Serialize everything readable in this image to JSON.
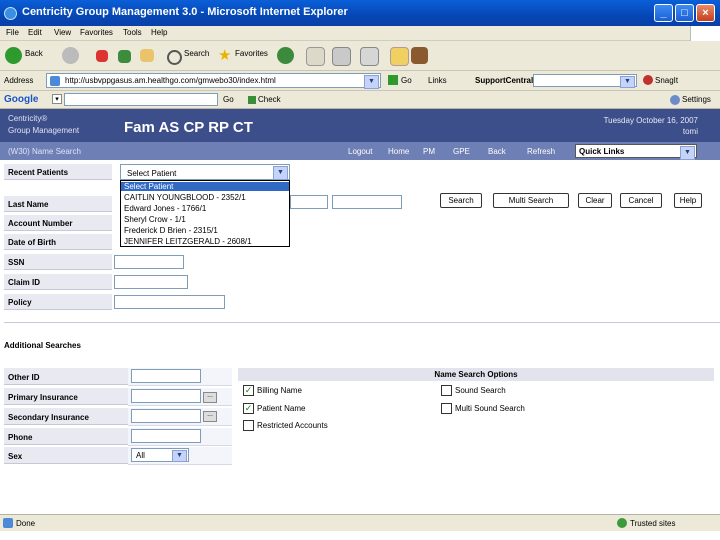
{
  "window": {
    "title": "Centricity Group Management 3.0 - Microsoft Internet Explorer"
  },
  "menu": [
    "File",
    "Edit",
    "View",
    "Favorites",
    "Tools",
    "Help"
  ],
  "toolbar": {
    "back": "Back",
    "search": "Search",
    "favorites": "Favorites"
  },
  "address": {
    "label": "Address",
    "url": "http://usbvppgasus.am.healthgo.com/gmwebo30/index.html",
    "go": "Go",
    "links": "Links",
    "extra": "SupportCentral",
    "snagit": "SnagIt"
  },
  "google": {
    "logo": "Google",
    "go": "Go",
    "check": "Check",
    "settings": "Settings"
  },
  "app": {
    "brand_line1": "Centricity®",
    "brand_line2": "Group Management",
    "patient_header": "Fam AS CP RP CT",
    "date": "Tuesday October 16, 2007",
    "user": "tomi"
  },
  "nav": {
    "crumb": "(W30) Name Search",
    "logout": "Logout",
    "home": "Home",
    "pm": "PM",
    "gpe": "GPE",
    "back": "Back",
    "refresh": "Refresh",
    "quick_links": "Quick Links"
  },
  "form": {
    "recent_label": "Recent Patients",
    "recent_selected": "Select Patient",
    "recent_options": [
      "Select Patient",
      "CAITLIN YOUNGBLOOD - 2352/1",
      "Edward Jones - 1766/1",
      "Sheryl Crow - 1/1",
      "Frederick D Brien - 2315/1",
      "JENNIFER LEITZGERALD - 2608/1"
    ],
    "last_name": "Last Name",
    "account_number": "Account Number",
    "dob": "Date of Birth",
    "ssn": "SSN",
    "claim_id": "Claim ID",
    "policy": "Policy",
    "buttons": [
      "Search",
      "Multi Search",
      "Clear",
      "Cancel",
      "Help"
    ],
    "additional": "Additional Searches",
    "other_id": "Other ID",
    "primary_insurance": "Primary Insurance",
    "secondary_insurance": "Secondary Insurance",
    "phone": "Phone",
    "sex": "Sex",
    "sex_value": "All",
    "ellipsis": "...",
    "options_header": "Name Search Options",
    "opt_billing": "Billing Name",
    "opt_patient": "Patient Name",
    "opt_restricted": "Restricted Accounts",
    "opt_sound": "Sound Search",
    "opt_multisound": "Multi Sound Search"
  },
  "status": {
    "left": "Done",
    "zone": "Trusted sites"
  }
}
